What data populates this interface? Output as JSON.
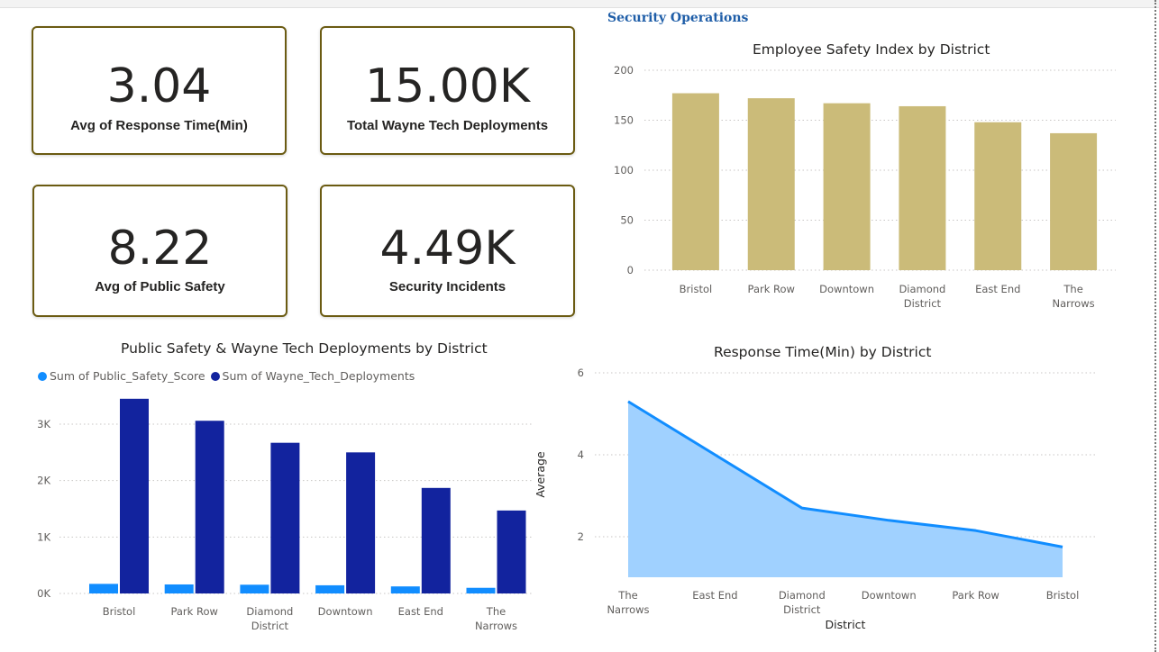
{
  "page": {
    "section_title": "Security Operations"
  },
  "kpis": [
    {
      "value": "3.04",
      "label": "Avg of Response Time(Min)"
    },
    {
      "value": "15.00K",
      "label": "Total Wayne Tech Deployments"
    },
    {
      "value": "8.22",
      "label": "Avg of Public Safety"
    },
    {
      "value": "4.49K",
      "label": "Security Incidents"
    }
  ],
  "colors": {
    "kpi_border": "#6b5b12",
    "bar_gold": "#cbbb79",
    "series_light": "#118dff",
    "series_dark": "#12239e",
    "area_fill": "#a0d1ff",
    "area_line": "#118dff",
    "section_title": "#1f5ea8"
  },
  "chart_data": [
    {
      "id": "safety_index",
      "type": "bar",
      "title": "Employee Safety Index by District",
      "categories": [
        "Bristol",
        "Park Row",
        "Downtown",
        "Diamond District",
        "East End",
        "The Narrows"
      ],
      "values": [
        177,
        172,
        167,
        164,
        148,
        137
      ],
      "yticks": [
        "0",
        "50",
        "100",
        "150",
        "200"
      ],
      "ylim": [
        0,
        200
      ],
      "grid": true
    },
    {
      "id": "deployments",
      "type": "bar",
      "title": "Public Safety & Wayne Tech Deployments by District",
      "categories": [
        "Bristol",
        "Park Row",
        "Diamond District",
        "Downtown",
        "East End",
        "The Narrows"
      ],
      "series": [
        {
          "name": "Sum of Public_Safety_Score",
          "values": [
            170,
            160,
            155,
            145,
            125,
            100
          ]
        },
        {
          "name": "Sum of Wayne_Tech_Deployments",
          "values": [
            3450,
            3060,
            2670,
            2500,
            1870,
            1470
          ]
        }
      ],
      "yticks": [
        "0K",
        "1K",
        "2K",
        "3K"
      ],
      "ylim": [
        0,
        3500
      ],
      "legend": "top-left",
      "grid": true
    },
    {
      "id": "response_time",
      "type": "area",
      "title": "Response Time(Min) by District",
      "xlabel": "District",
      "ylabel": "Average",
      "categories": [
        "The Narrows",
        "East End",
        "Diamond District",
        "Downtown",
        "Park Row",
        "Bristol"
      ],
      "values": [
        5.3,
        4.0,
        2.7,
        2.4,
        2.15,
        1.75
      ],
      "yticks": [
        "2",
        "4",
        "6"
      ],
      "ylim": [
        1.0,
        6.0
      ],
      "grid": true
    }
  ]
}
